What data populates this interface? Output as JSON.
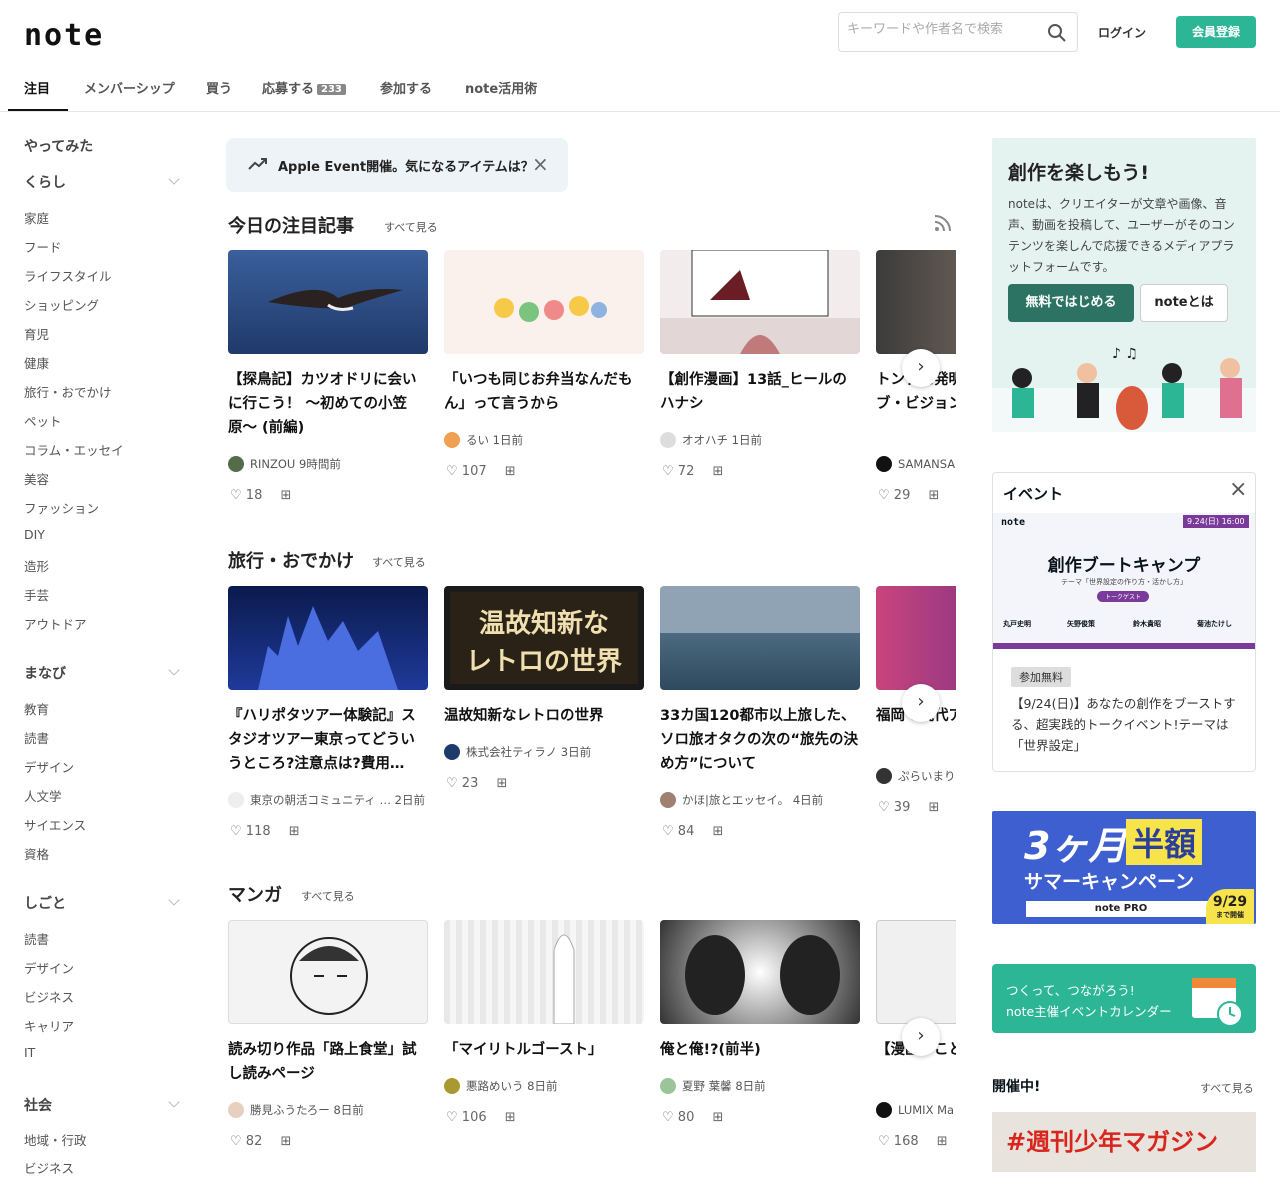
{
  "header": {
    "logo": "note",
    "search_placeholder": "キーワードや作者名で検索",
    "login": "ログイン",
    "signup": "会員登録"
  },
  "tabs": [
    {
      "label": "注目"
    },
    {
      "label": "メンバーシップ"
    },
    {
      "label": "買う"
    },
    {
      "label": "応募する",
      "badge": "233"
    },
    {
      "label": "参加する"
    },
    {
      "label": "note活用術"
    }
  ],
  "sidebar": {
    "top": "やってみた",
    "groups": [
      {
        "title": "くらし",
        "items": [
          "家庭",
          "フード",
          "ライフスタイル",
          "ショッピング",
          "育児",
          "健康",
          "旅行・おでかけ",
          "ペット",
          "コラム・エッセイ",
          "美容",
          "ファッション",
          "DIY",
          "造形",
          "手芸",
          "アウトドア"
        ]
      },
      {
        "title": "まなび",
        "items": [
          "教育",
          "読書",
          "デザイン",
          "人文学",
          "サイエンス",
          "資格"
        ]
      },
      {
        "title": "しごと",
        "items": [
          "読書",
          "デザイン",
          "ビジネス",
          "キャリア",
          "IT"
        ]
      },
      {
        "title": "社会",
        "items": [
          "地域・行政",
          "ビジネス"
        ]
      }
    ]
  },
  "banner": {
    "text": "Apple Event開催。気になるアイテムは？"
  },
  "sections": [
    {
      "title": "今日の注目記事",
      "see_all": "すべて見る",
      "cards": [
        {
          "title": "【探鳥記】カツオドリに会いに行こう！ 〜初めての小笠原〜 (前編)",
          "author": "RINZOU",
          "time": "9時間前",
          "likes": "18",
          "thumb_color": "#2b4f8a"
        },
        {
          "title": "「いつも同じお弁当なんだもん」って言うから",
          "author": "るい",
          "time": "1日前",
          "likes": "107",
          "thumb_color": "#fbf1ec"
        },
        {
          "title": "【創作漫画】13話_ヒールのハナシ",
          "author": "オオハチ",
          "time": "1日前",
          "likes": "72",
          "thumb_color": "#f2ecec"
        },
        {
          "title": "トンデモ発明ストーリー!?ーブ・ビジョン",
          "author": "SAMANSA",
          "time": "",
          "likes": "29",
          "thumb_color": "#6b5a4b"
        }
      ]
    },
    {
      "title": "旅行・おでかけ",
      "see_all": "すべて見る",
      "cards": [
        {
          "title": "『ハリポタツアー体験記』スタジオツアー東京ってどういうところ?注意点は?費用…",
          "author": "東京の朝活コミュニティ …",
          "time": "2日前",
          "likes": "118",
          "thumb_color": "#1c2f7a"
        },
        {
          "title": "温故知新なレトロの世界",
          "author": "株式会社ティラノ",
          "time": "3日前",
          "likes": "23",
          "thumb_color": "#3b2e1c"
        },
        {
          "title": "33カ国120都市以上旅した、ソロ旅オタクの次の“旅先の決め方”について",
          "author": "かほ|旅とエッセイ。",
          "time": "4日前",
          "likes": "84",
          "thumb_color": "#6f8aa0"
        },
        {
          "title": "福岡で現代アアートを",
          "author": "ぷらいまり",
          "time": "",
          "likes": "39",
          "thumb_color": "#c9447c"
        }
      ]
    },
    {
      "title": "マンガ",
      "see_all": "すべて見る",
      "cards": [
        {
          "title": "読み切り作品「路上食堂」試し読みページ",
          "author": "勝見ふうたろー",
          "time": "8日前",
          "likes": "82",
          "thumb_color": "#f3f3f3"
        },
        {
          "title": "「マイリトルゴースト」",
          "author": "悪路めいう",
          "time": "8日前",
          "likes": "106",
          "thumb_color": "#eeeeee"
        },
        {
          "title": "俺と俺!?(前半)",
          "author": "夏野 葉馨",
          "time": "8日前",
          "likes": "80",
          "thumb_color": "#bbbbbb"
        },
        {
          "title": "【漫画】ことわ共感できな",
          "author": "LUMIX Ma",
          "time": "",
          "likes": "168",
          "thumb_color": "#f0f0f0"
        }
      ]
    }
  ],
  "promo": {
    "title": "創作を楽しもう!",
    "body": "noteは、クリエイターが文章や画像、音声、動画を投稿して、ユーザーがそのコンテンツを楽しんで応援できるメディアプラットフォームです。",
    "btn_free": "無料ではじめる",
    "btn_about": "noteとは"
  },
  "event": {
    "heading": "イベント",
    "img_brand": "note",
    "img_date": "9.24(日) 16:00",
    "img_title": "創作ブートキャンプ",
    "img_sub": "テーマ「世界設定の作り方・活かし方」",
    "img_tag": "トークゲスト",
    "guests": [
      "丸戸史明",
      "矢野俊策",
      "鈴木貴昭",
      "菊池たけし"
    ],
    "free": "参加無料",
    "desc": "【9/24(日)】あなたの創作をブーストする、超実践的トークイベント!テーマは「世界設定」"
  },
  "campaign": {
    "line1": "3ヶ月",
    "half": "半額",
    "line2": "サマーキャンペーン",
    "brand": "note PRO",
    "date": "9/29",
    "date_sub": "まで開催"
  },
  "calendar": {
    "line1": "つくって、つながろう!",
    "line2": "note主催イベントカレンダー"
  },
  "now": {
    "title": "開催中!",
    "see_all": "すべて見る",
    "magazine": "#週刊少年マガジン"
  }
}
